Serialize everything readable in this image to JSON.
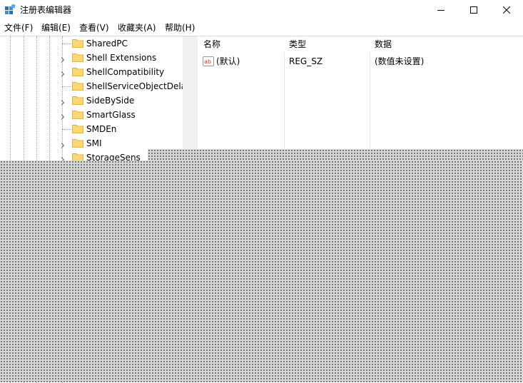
{
  "window": {
    "title": "注册表编辑器",
    "icon": "registry-editor-icon",
    "controls": [
      "minimize-icon",
      "maximize-icon",
      "close-icon"
    ]
  },
  "menu": {
    "items": [
      "文件(F)",
      "编辑(E)",
      "查看(V)",
      "收藏夹(A)",
      "帮助(H)"
    ]
  },
  "tree": {
    "items": [
      {
        "label": "SharedPC",
        "expandable": false
      },
      {
        "label": "Shell Extensions",
        "expandable": true
      },
      {
        "label": "ShellCompatibility",
        "expandable": true
      },
      {
        "label": "ShellServiceObjectDela",
        "expandable": false
      },
      {
        "label": "SideBySide",
        "expandable": true
      },
      {
        "label": "SmartGlass",
        "expandable": true
      },
      {
        "label": "SMDEn",
        "expandable": false
      },
      {
        "label": "SMI",
        "expandable": true
      },
      {
        "label": "StorageSens",
        "expandable": true
      }
    ]
  },
  "values": {
    "columns": {
      "name": "名称",
      "type": "类型",
      "data": "数据"
    },
    "rows": [
      {
        "name": "(默认)",
        "type": "REG_SZ",
        "data": "(数值未设置)",
        "icon": "string-value-icon"
      }
    ]
  },
  "colors": {
    "folder": "#f8d775",
    "folder_dark": "#e0b34a",
    "accent": "#1e73be",
    "overlay": "#d8d8d8"
  }
}
